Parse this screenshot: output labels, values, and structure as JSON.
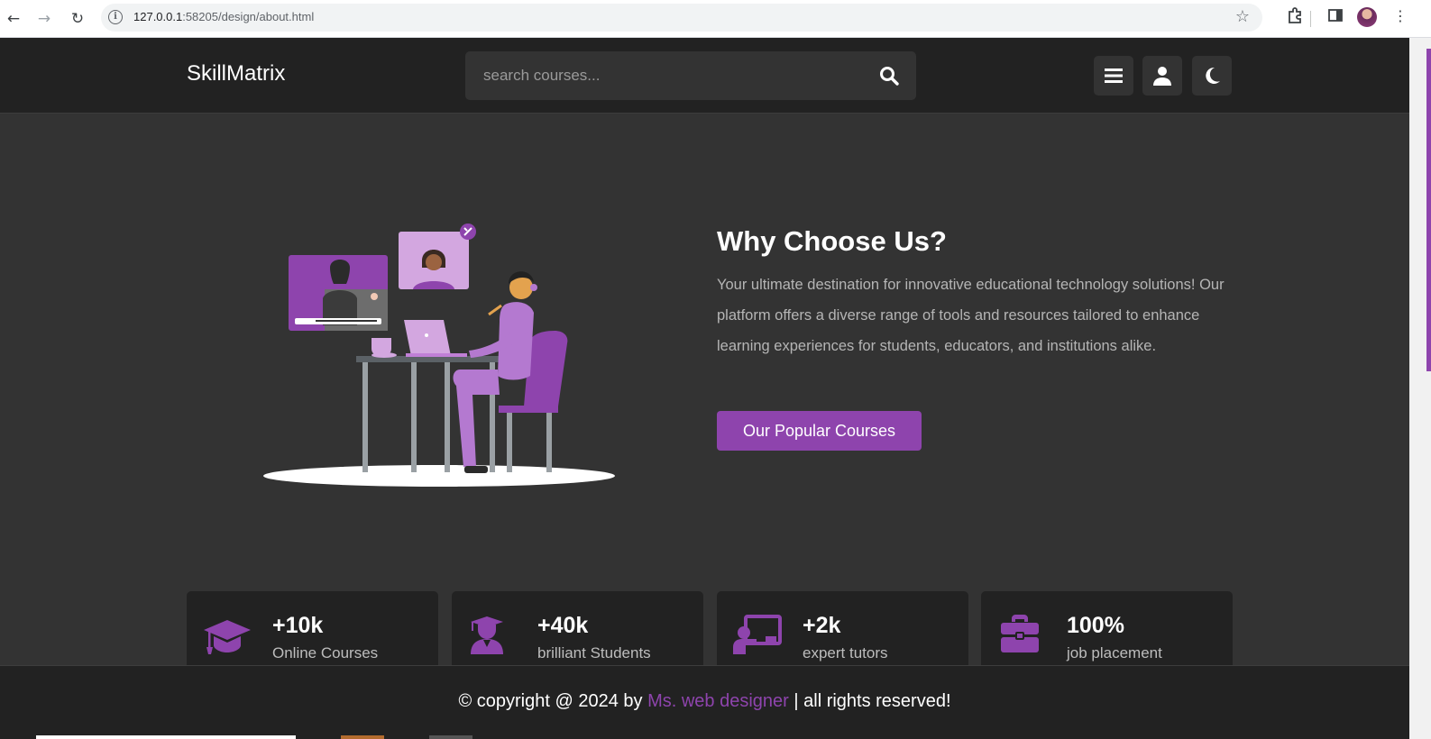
{
  "browser": {
    "url_host": "127.0.0.1",
    "url_rest": ":58205/design/about.html",
    "icons": [
      "back-icon",
      "forward-icon",
      "reload-icon",
      "site-info-icon",
      "bookmark-star-icon",
      "extensions-icon",
      "side-panel-icon",
      "profile-avatar",
      "more-menu-icon"
    ]
  },
  "header": {
    "logo": "SkillMatrix",
    "search_placeholder": "search courses...",
    "icons": [
      "search-icon",
      "menu-icon",
      "user-icon",
      "moon-icon"
    ]
  },
  "about": {
    "title": "Why Choose Us?",
    "paragraph": "Your ultimate destination for innovative educational technology solutions! Our platform offers a diverse range of tools and resources tailored to enhance learning experiences for students, educators, and institutions alike.",
    "button": "Our Popular Courses"
  },
  "stats": [
    {
      "icon": "graduation-cap-icon",
      "value": "+10k",
      "label": "Online Courses"
    },
    {
      "icon": "user-graduate-icon",
      "value": "+40k",
      "label": "brilliant Students"
    },
    {
      "icon": "chalkboard-teacher-icon",
      "value": "+2k",
      "label": "expert tutors"
    },
    {
      "icon": "briefcase-icon",
      "value": "100%",
      "label": "job placement"
    }
  ],
  "footer": {
    "prefix": "© copyright @ 2024 by ",
    "author": "Ms. web designer",
    "suffix": " | all rights reserved!"
  },
  "colors": {
    "accent": "#8e44ad",
    "header_bg": "#222222",
    "page_bg": "#333333"
  }
}
